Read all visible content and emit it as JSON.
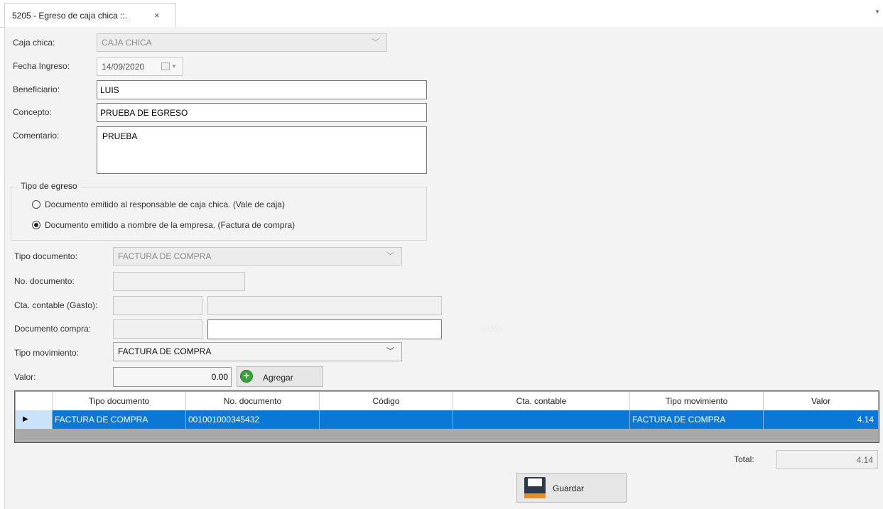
{
  "tab": {
    "title": "5205 - Egreso de caja chica ::.",
    "close": "×",
    "menu": "▼"
  },
  "form": {
    "caja_chica": {
      "label": "Caja chica:",
      "value": "CAJA CHICA"
    },
    "fecha": {
      "label": "Fecha Ingreso:",
      "value": "14/09/2020"
    },
    "beneficiario": {
      "label": "Beneficiario:",
      "value": "LUIS"
    },
    "concepto": {
      "label": "Concepto:",
      "value": "PRUEBA DE EGRESO"
    },
    "comentario": {
      "label": "Comentario:",
      "value": "PRUEBA"
    }
  },
  "tipo_egreso": {
    "title": "Tipo de egreso",
    "options": [
      {
        "label": "Documento emitido al responsable de caja chica. (Vale de caja)",
        "selected": false
      },
      {
        "label": "Documento emitido a nombre de la empresa. (Factura de compra)",
        "selected": true
      }
    ]
  },
  "detalle": {
    "tipo_documento": {
      "label": "Tipo documento:",
      "value": "FACTURA DE COMPRA"
    },
    "no_documento": {
      "label": "No. documento:",
      "value": ""
    },
    "cta_contable": {
      "label": "Cta. contable (Gasto):",
      "code": "",
      "name": ""
    },
    "documento_compra": {
      "label": "Documento compra:",
      "code": "",
      "value": "",
      "hint": "99355"
    },
    "tipo_movimiento": {
      "label": "Tipo movimiento:",
      "value": "FACTURA DE COMPRA"
    },
    "valor": {
      "label": "Valor:",
      "value": "0.00"
    },
    "agregar_label": "Agregar"
  },
  "grid": {
    "columns": [
      "Tipo documento",
      "No. documento",
      "Código",
      "Cta. contable",
      "Tipo movimiento",
      "Valor"
    ],
    "rows": [
      {
        "tipo_documento": "FACTURA DE COMPRA",
        "no_documento": "001001000345432",
        "codigo": "",
        "cta_contable": "",
        "tipo_movimiento": "FACTURA DE COMPRA",
        "valor": "4.14"
      }
    ]
  },
  "total": {
    "label": "Total:",
    "value": "4.14"
  },
  "save_label": "Guardar",
  "colors": {
    "selection": "#0a78d7",
    "panel": "#f3f3f3",
    "add_icon": "#3aa43a",
    "floppy_stripe": "#f08a1c"
  }
}
